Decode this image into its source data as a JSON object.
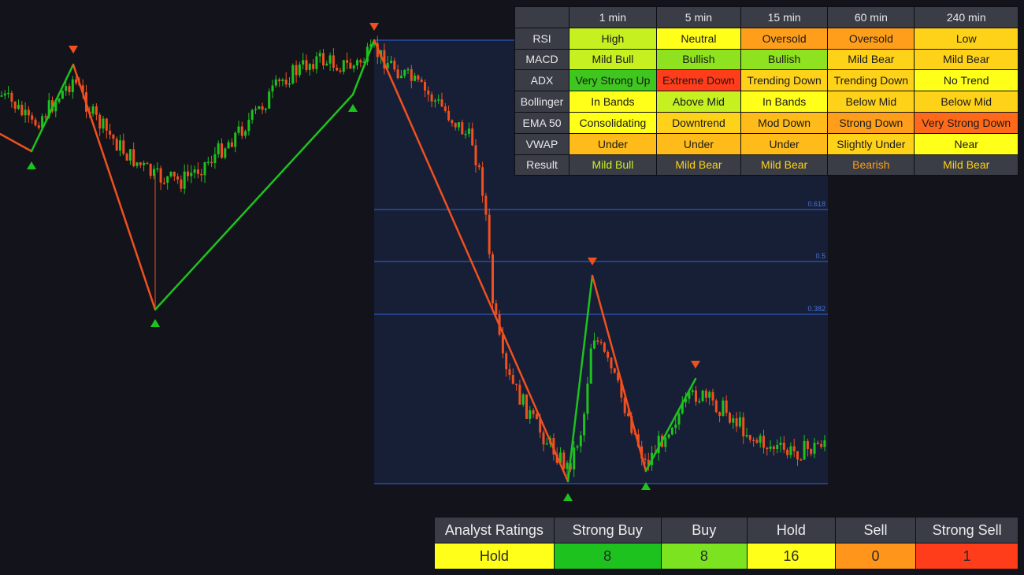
{
  "indicator_table": {
    "columns": [
      "1 min",
      "5 min",
      "15 min",
      "60 min",
      "240 min"
    ],
    "rows": [
      {
        "label": "RSI",
        "cells": [
          {
            "text": "High",
            "bg": "#c6f01f"
          },
          {
            "text": "Neutral",
            "bg": "#ffff1a"
          },
          {
            "text": "Oversold",
            "bg": "#ff9e1a"
          },
          {
            "text": "Oversold",
            "bg": "#ff9e1a"
          },
          {
            "text": "Low",
            "bg": "#ffd21a"
          }
        ]
      },
      {
        "label": "MACD",
        "cells": [
          {
            "text": "Mild Bull",
            "bg": "#c6f01f"
          },
          {
            "text": "Bullish",
            "bg": "#8ee21f"
          },
          {
            "text": "Bullish",
            "bg": "#8ee21f"
          },
          {
            "text": "Mild Bear",
            "bg": "#ffd21a"
          },
          {
            "text": "Mild Bear",
            "bg": "#ffd21a"
          }
        ]
      },
      {
        "label": "ADX",
        "cells": [
          {
            "text": "Very Strong Up",
            "bg": "#3fc61f"
          },
          {
            "text": "Extreme Down",
            "bg": "#ff3d1a"
          },
          {
            "text": "Trending Down",
            "bg": "#ffd21a"
          },
          {
            "text": "Trending Down",
            "bg": "#ffd21a"
          },
          {
            "text": "No Trend",
            "bg": "#ffff1a"
          }
        ]
      },
      {
        "label": "Bollinger",
        "cells": [
          {
            "text": "In Bands",
            "bg": "#ffff1a"
          },
          {
            "text": "Above Mid",
            "bg": "#c6f01f"
          },
          {
            "text": "In Bands",
            "bg": "#ffff1a"
          },
          {
            "text": "Below Mid",
            "bg": "#ffd21a"
          },
          {
            "text": "Below Mid",
            "bg": "#ffd21a"
          }
        ]
      },
      {
        "label": "EMA 50",
        "cells": [
          {
            "text": "Consolidating",
            "bg": "#ffff1a"
          },
          {
            "text": "Downtrend",
            "bg": "#ffd21a"
          },
          {
            "text": "Mod Down",
            "bg": "#ffbb1a"
          },
          {
            "text": "Strong Down",
            "bg": "#ff9e1a"
          },
          {
            "text": "Very Strong Down",
            "bg": "#ff6a1a"
          }
        ]
      },
      {
        "label": "VWAP",
        "cells": [
          {
            "text": "Under",
            "bg": "#ffbb1a"
          },
          {
            "text": "Under",
            "bg": "#ffbb1a"
          },
          {
            "text": "Under",
            "bg": "#ffbb1a"
          },
          {
            "text": "Slightly Under",
            "bg": "#ffd21a"
          },
          {
            "text": "Near",
            "bg": "#ffff1a"
          }
        ]
      }
    ],
    "result": {
      "label": "Result",
      "cells": [
        {
          "text": "Mild Bull",
          "color": "#c6f01f"
        },
        {
          "text": "Mild Bear",
          "color": "#ffd21a"
        },
        {
          "text": "Mild Bear",
          "color": "#ffd21a"
        },
        {
          "text": "Bearish",
          "color": "#ff9e1a"
        },
        {
          "text": "Mild Bear",
          "color": "#ffd21a"
        }
      ]
    }
  },
  "ratings": {
    "headers": [
      "Analyst Ratings",
      "Strong Buy",
      "Buy",
      "Hold",
      "Sell",
      "Strong Sell"
    ],
    "values": [
      {
        "text": "Hold",
        "bg": "#ffff1a"
      },
      {
        "text": "8",
        "bg": "#1ec21e"
      },
      {
        "text": "8",
        "bg": "#7be31f"
      },
      {
        "text": "16",
        "bg": "#ffff1a"
      },
      {
        "text": "0",
        "bg": "#ff951a"
      },
      {
        "text": "1",
        "bg": "#ff3d1a"
      }
    ]
  },
  "chart": {
    "colors": {
      "up": "#1ec21e",
      "down": "#f0501f",
      "zigzag_up": "#1ec21e",
      "zigzag_down": "#f0501f",
      "fib_line": "#3563d6",
      "fib_zone": "#1a2340"
    },
    "fib_labels": [
      "0.618",
      "0.5",
      "0.382"
    ]
  }
}
